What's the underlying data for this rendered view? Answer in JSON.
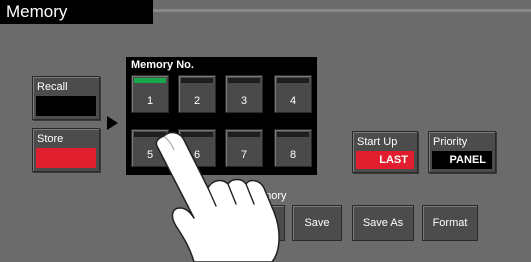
{
  "title": "Memory",
  "recall": {
    "label": "Recall"
  },
  "store": {
    "label": "Store"
  },
  "memory_group": {
    "title": "Memory No.",
    "slots": [
      "1",
      "2",
      "3",
      "4",
      "5",
      "6",
      "7",
      "8"
    ]
  },
  "startup": {
    "label": "Start Up",
    "value": "LAST"
  },
  "priority": {
    "label": "Priority",
    "value": "PANEL"
  },
  "usb_section": {
    "title_partial": "emory"
  },
  "buttons": {
    "save": "Save",
    "save_as": "Save As",
    "format": "Format"
  },
  "colors": {
    "red": "#e01e2e",
    "active_green": "#19a84a",
    "background": "#6b6b6b"
  },
  "overlay": {
    "icon": "pointing-hand-icon"
  }
}
